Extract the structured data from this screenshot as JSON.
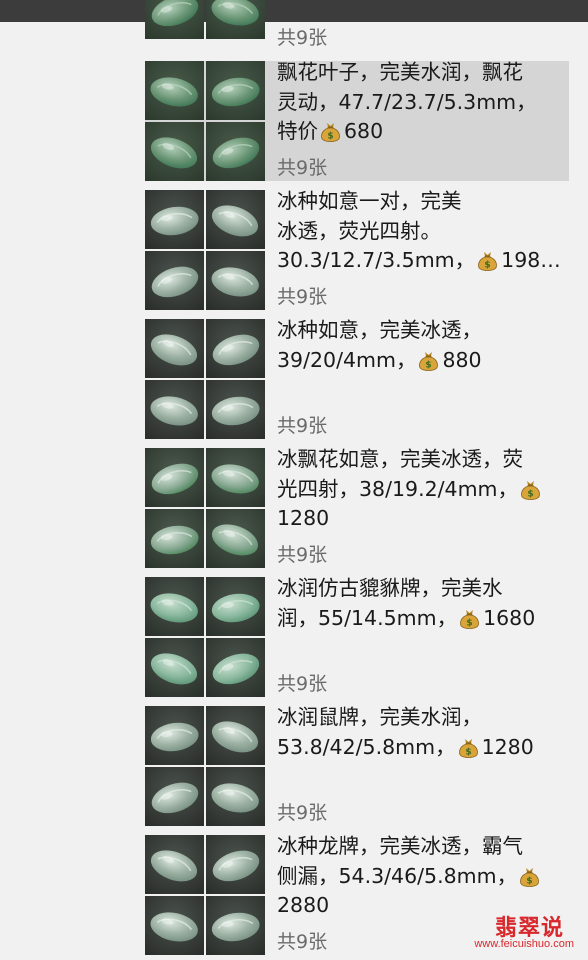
{
  "posts": [
    {
      "id": "p0",
      "lines": [
        "共9张"
      ],
      "count": "",
      "price": "",
      "palette": "green"
    },
    {
      "id": "p1",
      "lines": [
        "飘花叶子，完美水润，飘花",
        "灵动，47.7/23.7/5.3mm，",
        "特价"
      ],
      "price": "680",
      "count": "共9张",
      "palette": "green"
    },
    {
      "id": "p2",
      "lines": [
        "冰种如意一对，完美",
        "冰透，荧光四射。",
        "30.3/12.7/3.5mm，"
      ],
      "price": "198…",
      "count": "共9张",
      "palette": "clear"
    },
    {
      "id": "p3",
      "lines": [
        "冰种如意，完美冰透，",
        "39/20/4mm，"
      ],
      "price": "880",
      "count": "共9张",
      "palette": "clear"
    },
    {
      "id": "p4",
      "lines": [
        "冰飘花如意，完美冰透，荧",
        "光四射，38/19.2/4mm，",
        "1280"
      ],
      "price": "",
      "count": "共9张",
      "palette": "greenclear"
    },
    {
      "id": "p5",
      "lines": [
        "冰润仿古貔貅牌，完美水",
        "润，55/14.5mm，"
      ],
      "price": "1680",
      "count": "共9张",
      "palette": "pale"
    },
    {
      "id": "p6",
      "lines": [
        "冰润鼠牌，完美水润，",
        "53.8/42/5.8mm，"
      ],
      "price": "1280",
      "count": "共9张",
      "palette": "clear"
    },
    {
      "id": "p7",
      "lines": [
        "冰种龙牌，完美冰透，霸气",
        "侧漏，54.3/46/5.8mm，",
        "2880"
      ],
      "price": "",
      "count": "共9张",
      "palette": "clear"
    }
  ],
  "watermark": {
    "title": "翡翠说",
    "url": "www.feicuishuo.com"
  },
  "colors": {
    "highlight": "#d5d5d5",
    "count_text": "#6b6b6b",
    "watermark": "#d8282c",
    "topbar": "#3c3c3c"
  },
  "icons": {
    "price": "money-bag-icon"
  }
}
